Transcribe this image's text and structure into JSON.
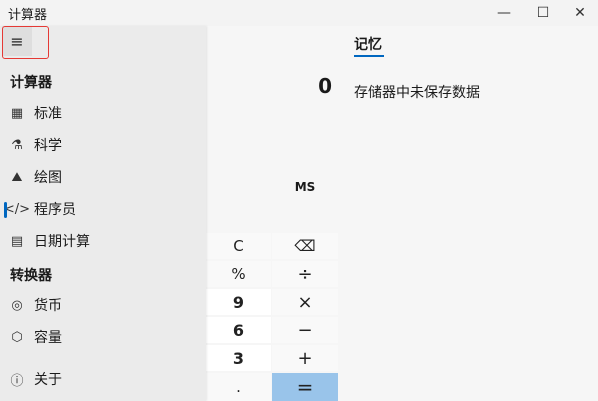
{
  "window": {
    "title": "计算器",
    "minimize": "—",
    "maximize": "☐",
    "close": "✕"
  },
  "nav": {
    "menu_icon": "≡",
    "section_calculator": "计算器",
    "section_converter": "转换器",
    "items": [
      {
        "icon": "▦",
        "label": "标准"
      },
      {
        "icon": "⚗",
        "label": "科学"
      },
      {
        "icon": "⛰",
        "label": "绘图"
      },
      {
        "icon": "</>",
        "label": "程序员"
      },
      {
        "icon": "▤",
        "label": "日期计算"
      },
      {
        "icon": "◎",
        "label": "货币"
      },
      {
        "icon": "⬡",
        "label": "容量"
      },
      {
        "icon": "ⓘ",
        "label": "关于"
      }
    ]
  },
  "memory": {
    "tab": "记忆",
    "empty_message": "存储器中未保存数据"
  },
  "display": {
    "value": "0"
  },
  "keypad": {
    "ms": "MS",
    "clear": "C",
    "backspace": "⌫",
    "percent": "%",
    "divide": "÷",
    "nine": "9",
    "multiply": "×",
    "six": "6",
    "minus": "−",
    "three": "3",
    "plus": "+",
    "decimal": ".",
    "equals": "="
  }
}
